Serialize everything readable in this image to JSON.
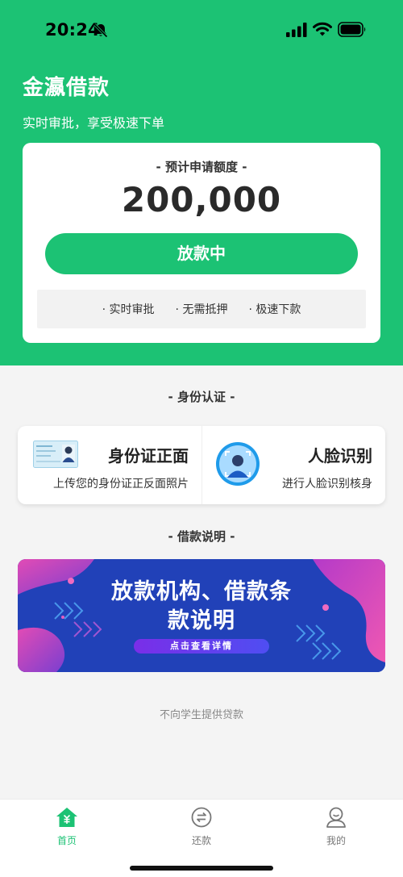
{
  "status_bar": {
    "time": "20:24"
  },
  "header": {
    "app_title": "金瀛借款",
    "subtitle": "实时审批，享受极速下单"
  },
  "quota_card": {
    "label": "- 预计申请额度 -",
    "amount": "200,000",
    "button_label": "放款中",
    "features": [
      "· 实时审批",
      "· 无需抵押",
      "· 极速下款"
    ]
  },
  "identity": {
    "section_title": "- 身份认证 -",
    "id_card": {
      "title": "身份证正面",
      "desc": "上传您的身份证正反面照片"
    },
    "face": {
      "title": "人脸识别",
      "desc": "进行人脸识别核身"
    }
  },
  "loan_info": {
    "section_title": "- 借款说明 -",
    "banner_title_line1": "放款机构、借款条",
    "banner_title_line2": "款说明",
    "banner_button": "点击查看详情"
  },
  "disclaimer": "不向学生提供贷款",
  "tabs": [
    {
      "label": "首页",
      "icon": "home-icon",
      "active": true
    },
    {
      "label": "还款",
      "icon": "repay-icon",
      "active": false
    },
    {
      "label": "我的",
      "icon": "profile-icon",
      "active": false
    }
  ],
  "colors": {
    "brand_green": "#1cc274",
    "banner_blue": "#2141b8",
    "banner_pink": "#c0409a"
  }
}
